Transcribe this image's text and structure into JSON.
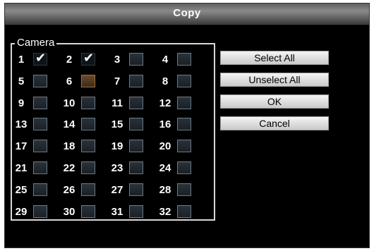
{
  "dialog": {
    "title": "Copy"
  },
  "camera_group": {
    "label": "Camera",
    "cameras": [
      {
        "num": "1",
        "checked": true
      },
      {
        "num": "2",
        "checked": true
      },
      {
        "num": "3",
        "checked": false
      },
      {
        "num": "4",
        "checked": false
      },
      {
        "num": "5",
        "checked": false
      },
      {
        "num": "6",
        "checked": false
      },
      {
        "num": "7",
        "checked": false
      },
      {
        "num": "8",
        "checked": false
      },
      {
        "num": "9",
        "checked": false
      },
      {
        "num": "10",
        "checked": false
      },
      {
        "num": "11",
        "checked": false
      },
      {
        "num": "12",
        "checked": false
      },
      {
        "num": "13",
        "checked": false
      },
      {
        "num": "14",
        "checked": false
      },
      {
        "num": "15",
        "checked": false
      },
      {
        "num": "16",
        "checked": false
      },
      {
        "num": "17",
        "checked": false
      },
      {
        "num": "18",
        "checked": false
      },
      {
        "num": "19",
        "checked": false
      },
      {
        "num": "20",
        "checked": false
      },
      {
        "num": "21",
        "checked": false
      },
      {
        "num": "22",
        "checked": false
      },
      {
        "num": "23",
        "checked": false
      },
      {
        "num": "24",
        "checked": false
      },
      {
        "num": "25",
        "checked": false
      },
      {
        "num": "26",
        "checked": false
      },
      {
        "num": "27",
        "checked": false
      },
      {
        "num": "28",
        "checked": false
      },
      {
        "num": "29",
        "checked": false
      },
      {
        "num": "30",
        "checked": false
      },
      {
        "num": "31",
        "checked": false
      },
      {
        "num": "32",
        "checked": false
      }
    ]
  },
  "buttons": {
    "select_all": "Select All",
    "unselect_all": "Unselect All",
    "ok": "OK",
    "cancel": "Cancel"
  },
  "colors": {
    "background": "#000000",
    "title_bar": "#7a7a7a",
    "button_face": "#dcdcdc"
  }
}
